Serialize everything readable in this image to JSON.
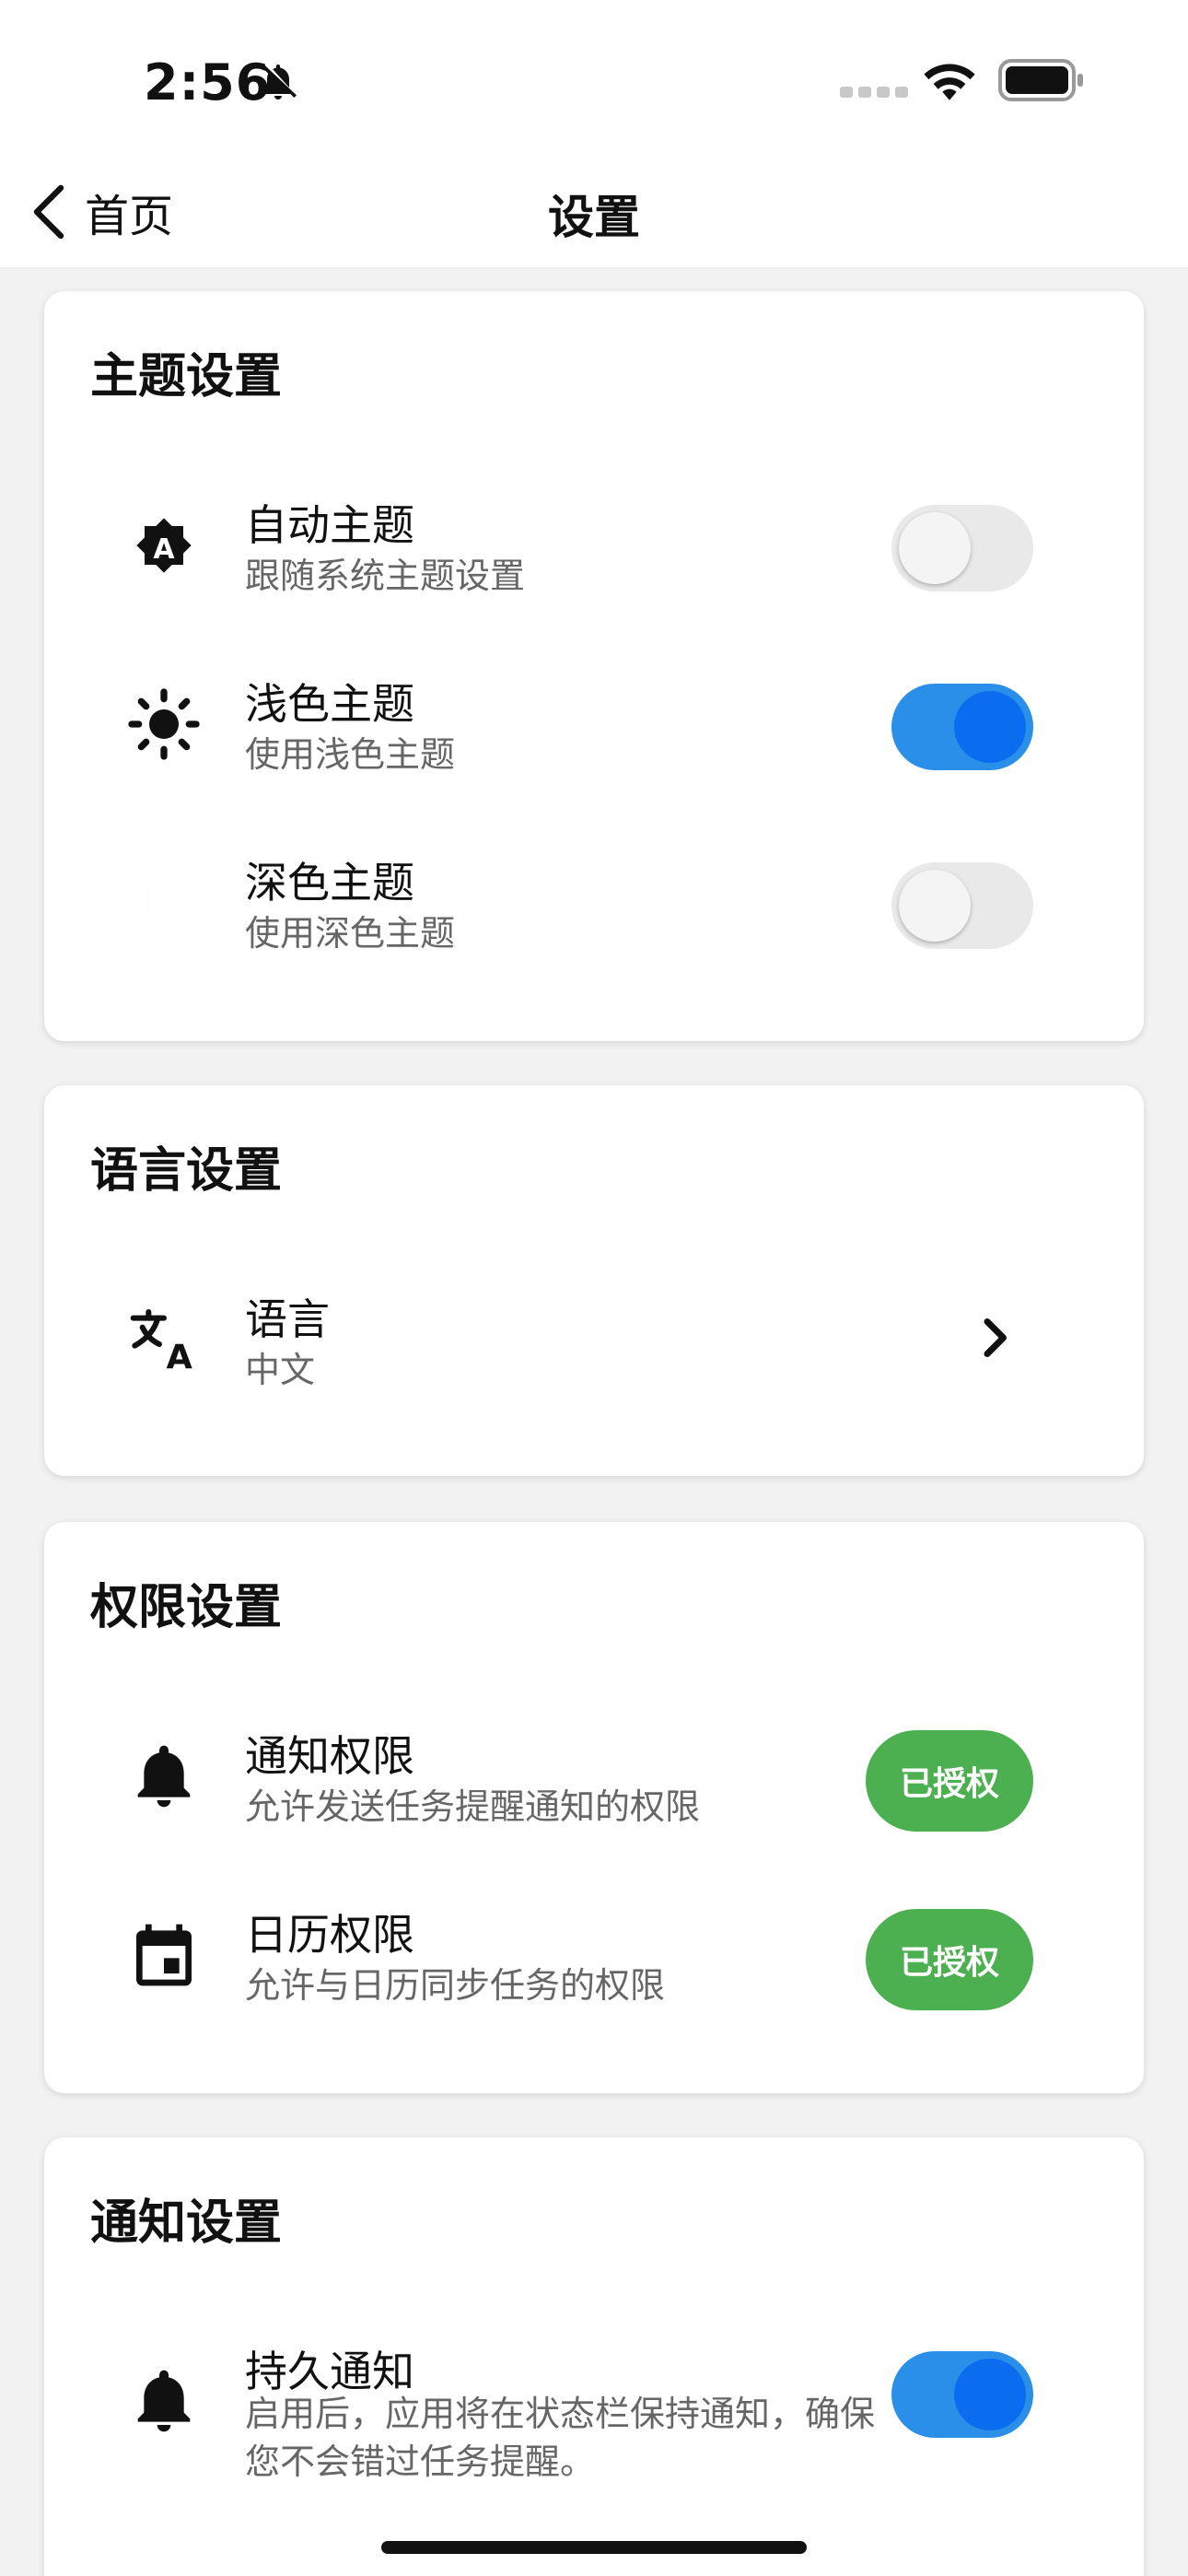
{
  "status_bar": {
    "time": "2:56"
  },
  "nav": {
    "back_label": "首页",
    "title": "设置"
  },
  "theme": {
    "title": "主题设置",
    "items": [
      {
        "title": "自动主题",
        "subtitle": "跟随系统主题设置",
        "icon": "auto-theme-icon",
        "enabled": false
      },
      {
        "title": "浅色主题",
        "subtitle": "使用浅色主题",
        "icon": "sun-icon",
        "enabled": true
      },
      {
        "title": "深色主题",
        "subtitle": "使用深色主题",
        "icon": "moon-icon",
        "enabled": false
      }
    ]
  },
  "language": {
    "title": "语言设置",
    "item": {
      "title": "语言",
      "value": "中文",
      "icon": "translate-icon"
    }
  },
  "permissions": {
    "title": "权限设置",
    "items": [
      {
        "title": "通知权限",
        "subtitle": "允许发送任务提醒通知的权限",
        "icon": "bell-icon",
        "status": "已授权"
      },
      {
        "title": "日历权限",
        "subtitle": "允许与日历同步任务的权限",
        "icon": "calendar-icon",
        "status": "已授权"
      }
    ]
  },
  "notifications": {
    "title": "通知设置",
    "item": {
      "title": "持久通知",
      "subtitle": "启用后，应用将在状态栏保持通知，确保您不会错过任务提醒。",
      "icon": "bell-icon",
      "enabled": true
    }
  },
  "colors": {
    "accent": "#0a6df0",
    "toggle_on_track": "#2a8fe8",
    "granted": "#4caf50",
    "background": "#f2f2f2"
  }
}
